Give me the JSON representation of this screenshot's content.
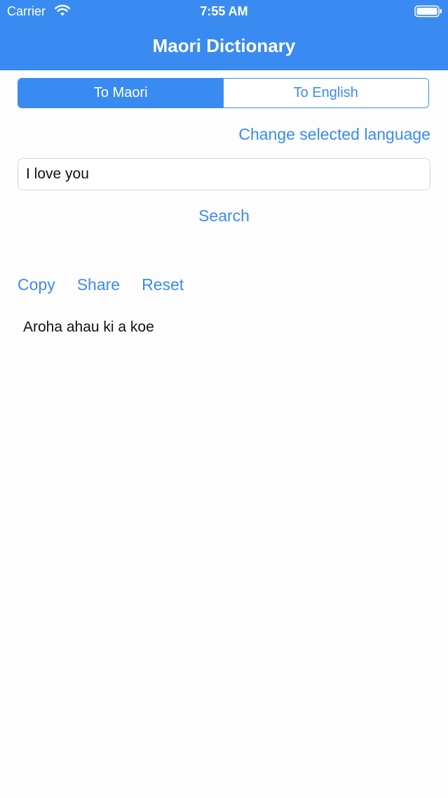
{
  "status_bar": {
    "carrier": "Carrier",
    "time": "7:55 AM",
    "icons": [
      "wifi-icon",
      "battery-icon"
    ]
  },
  "nav": {
    "title": "Maori Dictionary"
  },
  "segmented": {
    "options": [
      "To Maori",
      "To English"
    ],
    "selected": "To Maori"
  },
  "change_language_label": "Change selected language",
  "search": {
    "input_value": "I love you",
    "button_label": "Search"
  },
  "actions": {
    "copy": "Copy",
    "share": "Share",
    "reset": "Reset"
  },
  "result_text": "Aroha ahau ki a koe",
  "colors": {
    "accent": "#3a8bf1",
    "background": "#fdfdfe",
    "text": "#111111"
  }
}
